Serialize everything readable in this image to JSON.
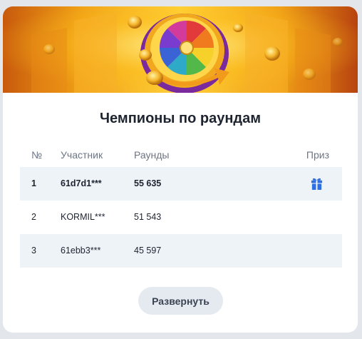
{
  "title": "Чемпионы по раундам",
  "table": {
    "headers": {
      "num": "№",
      "participant": "Участник",
      "rounds": "Раунды",
      "prize": "Приз"
    },
    "rows": [
      {
        "rank": "1",
        "participant": "61d7d1***",
        "rounds": "55 635",
        "prize_icon": "gift-icon"
      },
      {
        "rank": "2",
        "participant": "KORMIL***",
        "rounds": "51 543"
      },
      {
        "rank": "3",
        "participant": "61ebb3***",
        "rounds": "45 597"
      }
    ]
  },
  "expand_button": "Развернуть",
  "colors": {
    "accent": "#2f6fe0",
    "row_highlight": "#eef3f8",
    "banner_gold": "#ffd23a",
    "banner_orange": "#e8840f"
  }
}
